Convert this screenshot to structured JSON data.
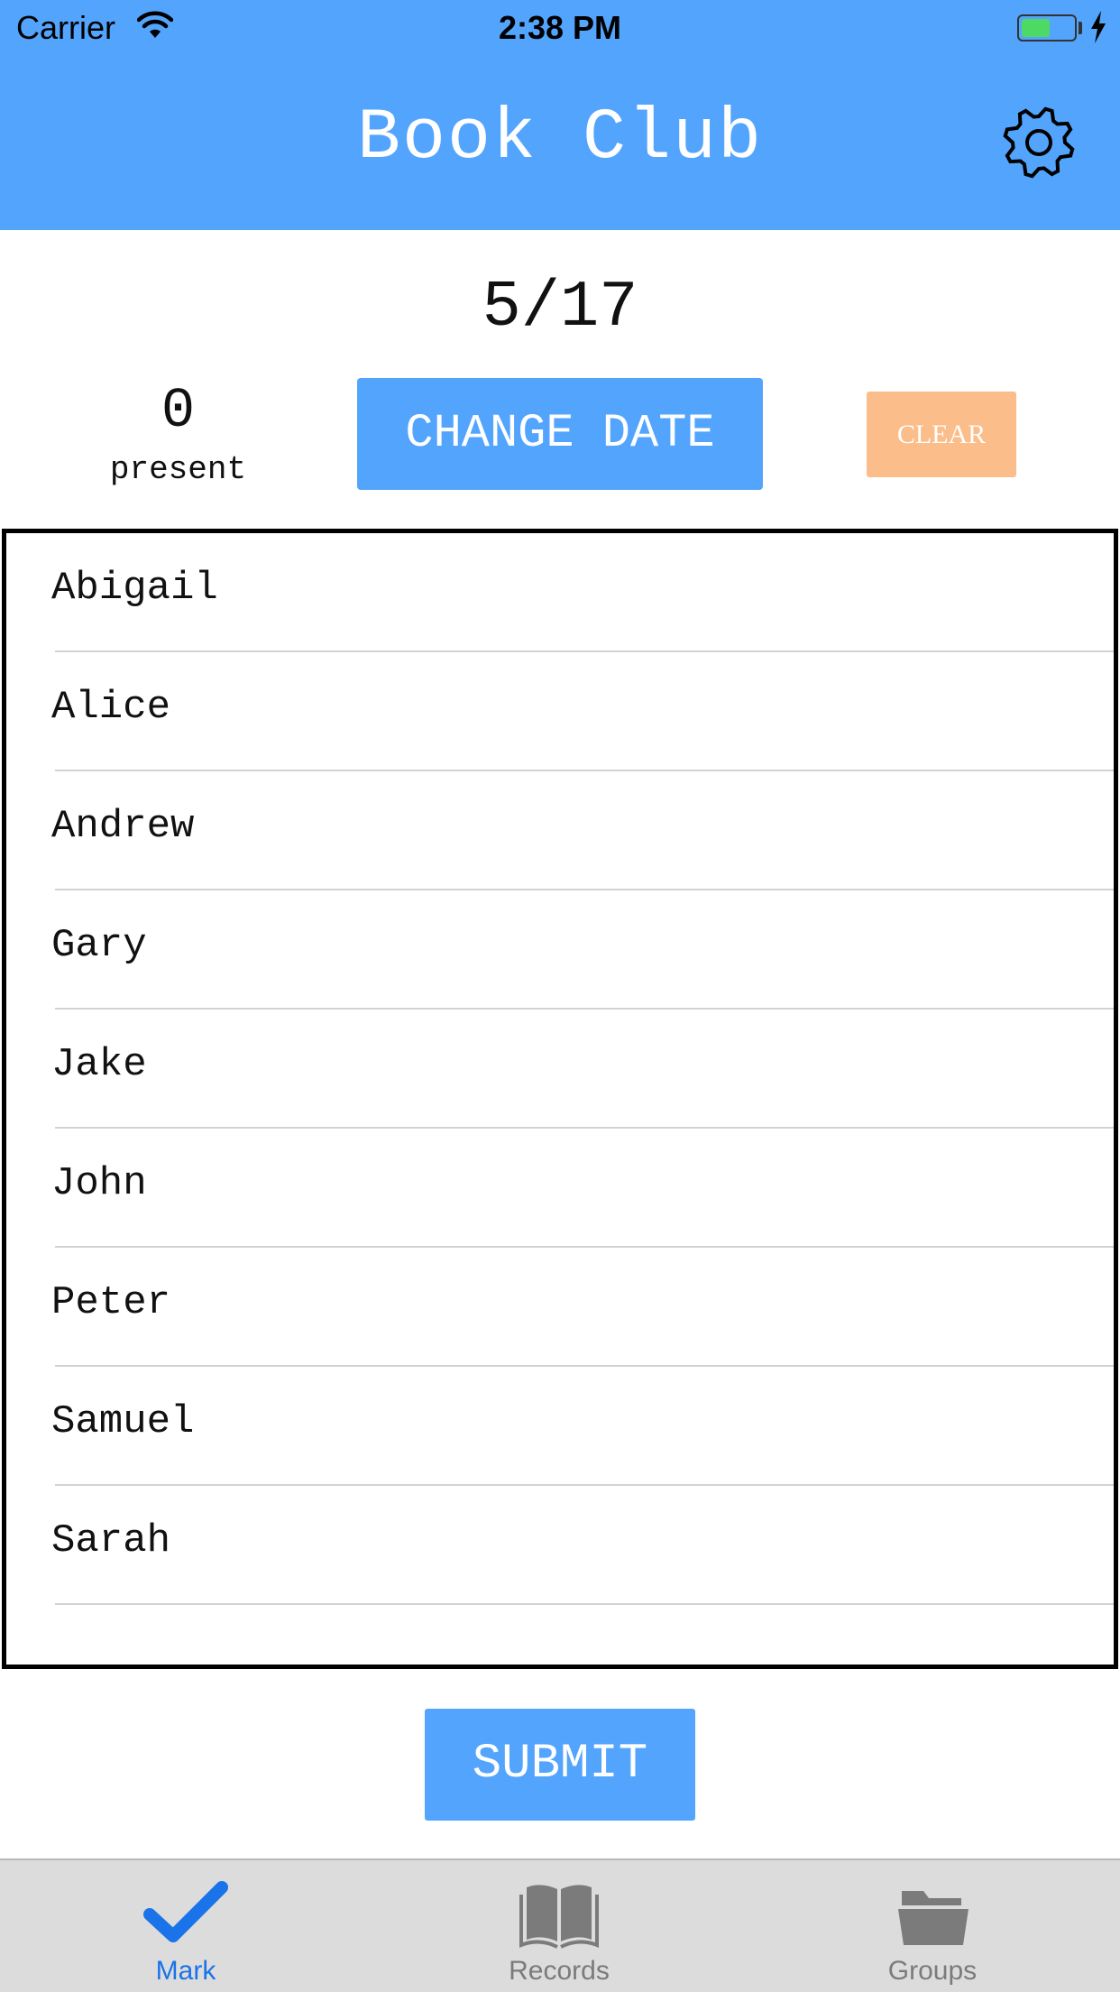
{
  "status_bar": {
    "carrier": "Carrier",
    "time": "2:38 PM",
    "battery_level": 0.55
  },
  "header": {
    "title": "Book Club",
    "settings_icon": "gear-icon"
  },
  "date": "5/17",
  "attendance": {
    "count": "0",
    "label": "present"
  },
  "buttons": {
    "change_date": "CHANGE DATE",
    "clear": "CLEAR",
    "submit": "SUBMIT"
  },
  "members": [
    "Abigail",
    "Alice",
    "Andrew",
    "Gary",
    "Jake",
    "John",
    "Peter",
    "Samuel",
    "Sarah"
  ],
  "tabs": [
    {
      "label": "Mark",
      "icon": "checkmark-icon",
      "active": true
    },
    {
      "label": "Records",
      "icon": "book-icon",
      "active": false
    },
    {
      "label": "Groups",
      "icon": "folder-icon",
      "active": false
    }
  ],
  "colors": {
    "accent": "#53a4fd",
    "clear_button": "#fbbd89",
    "active_tab": "#1a73e8",
    "inactive_tab": "#7b7b7b"
  }
}
